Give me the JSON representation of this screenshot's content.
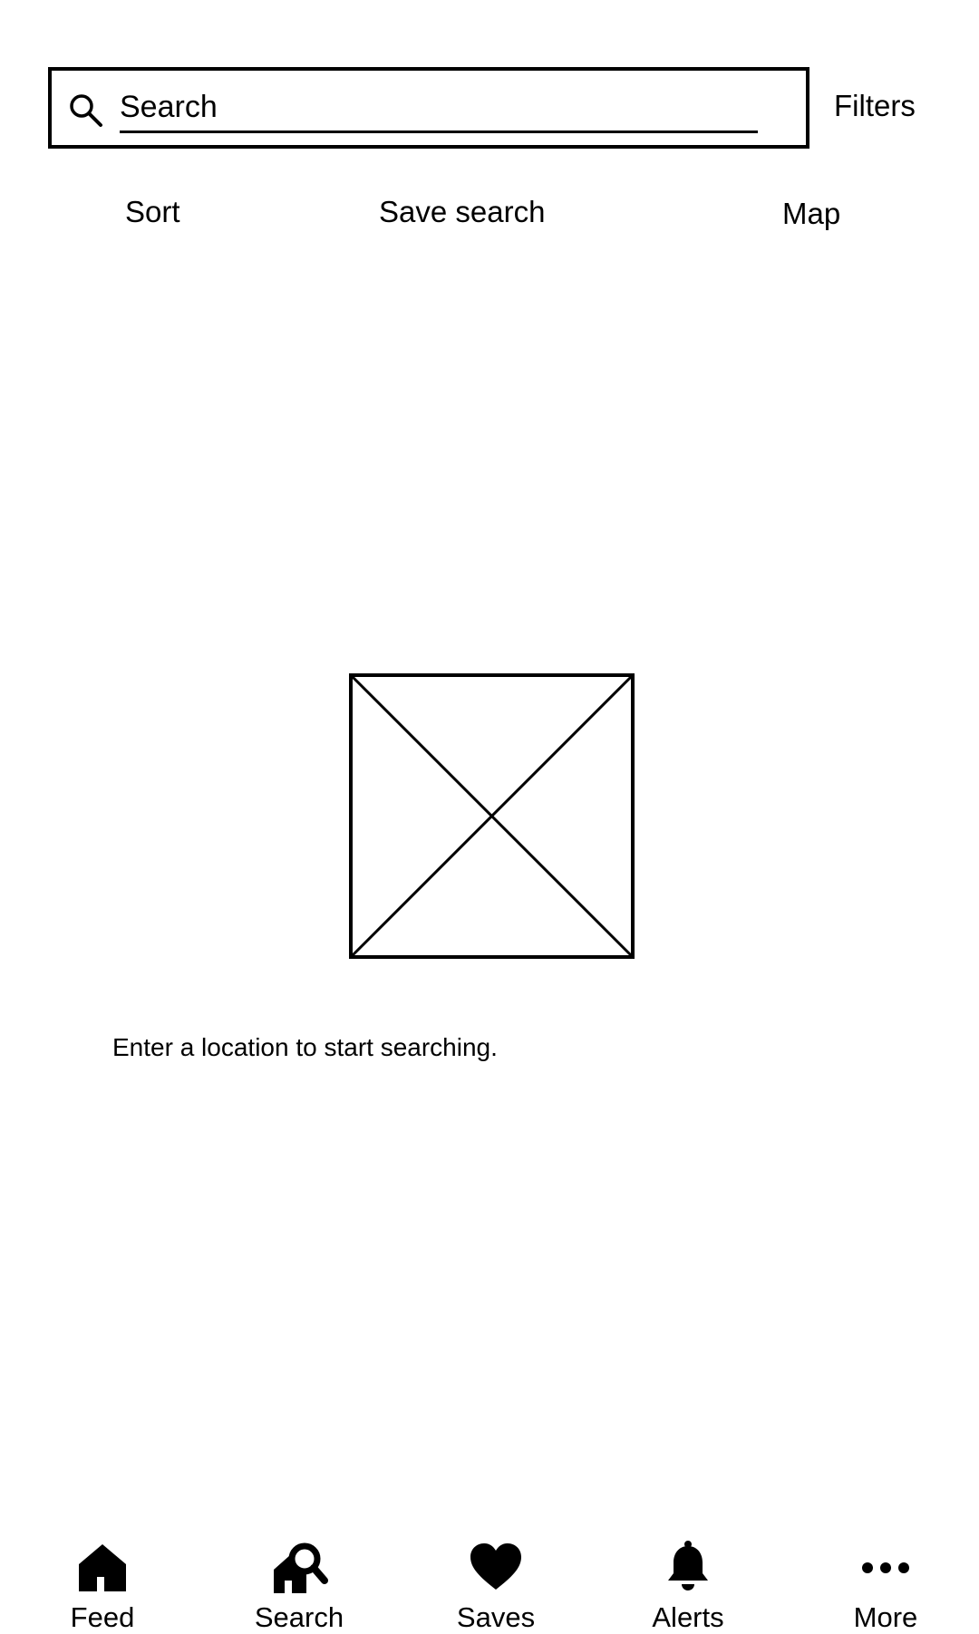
{
  "search": {
    "placeholder": "Search",
    "icon": "search-icon"
  },
  "header": {
    "filters_label": "Filters"
  },
  "actions": {
    "sort_label": "Sort",
    "save_search_label": "Save search",
    "map_label": "Map"
  },
  "empty_state": {
    "image_icon": "image-placeholder-icon",
    "message": "Enter a location to start searching."
  },
  "bottom_nav": {
    "items": [
      {
        "label": "Feed",
        "icon": "home-icon"
      },
      {
        "label": "Search",
        "icon": "home-search-icon"
      },
      {
        "label": "Saves",
        "icon": "heart-icon"
      },
      {
        "label": "Alerts",
        "icon": "bell-icon"
      },
      {
        "label": "More",
        "icon": "more-dots-icon"
      }
    ]
  },
  "colors": {
    "foreground": "#000000",
    "background": "#ffffff"
  }
}
